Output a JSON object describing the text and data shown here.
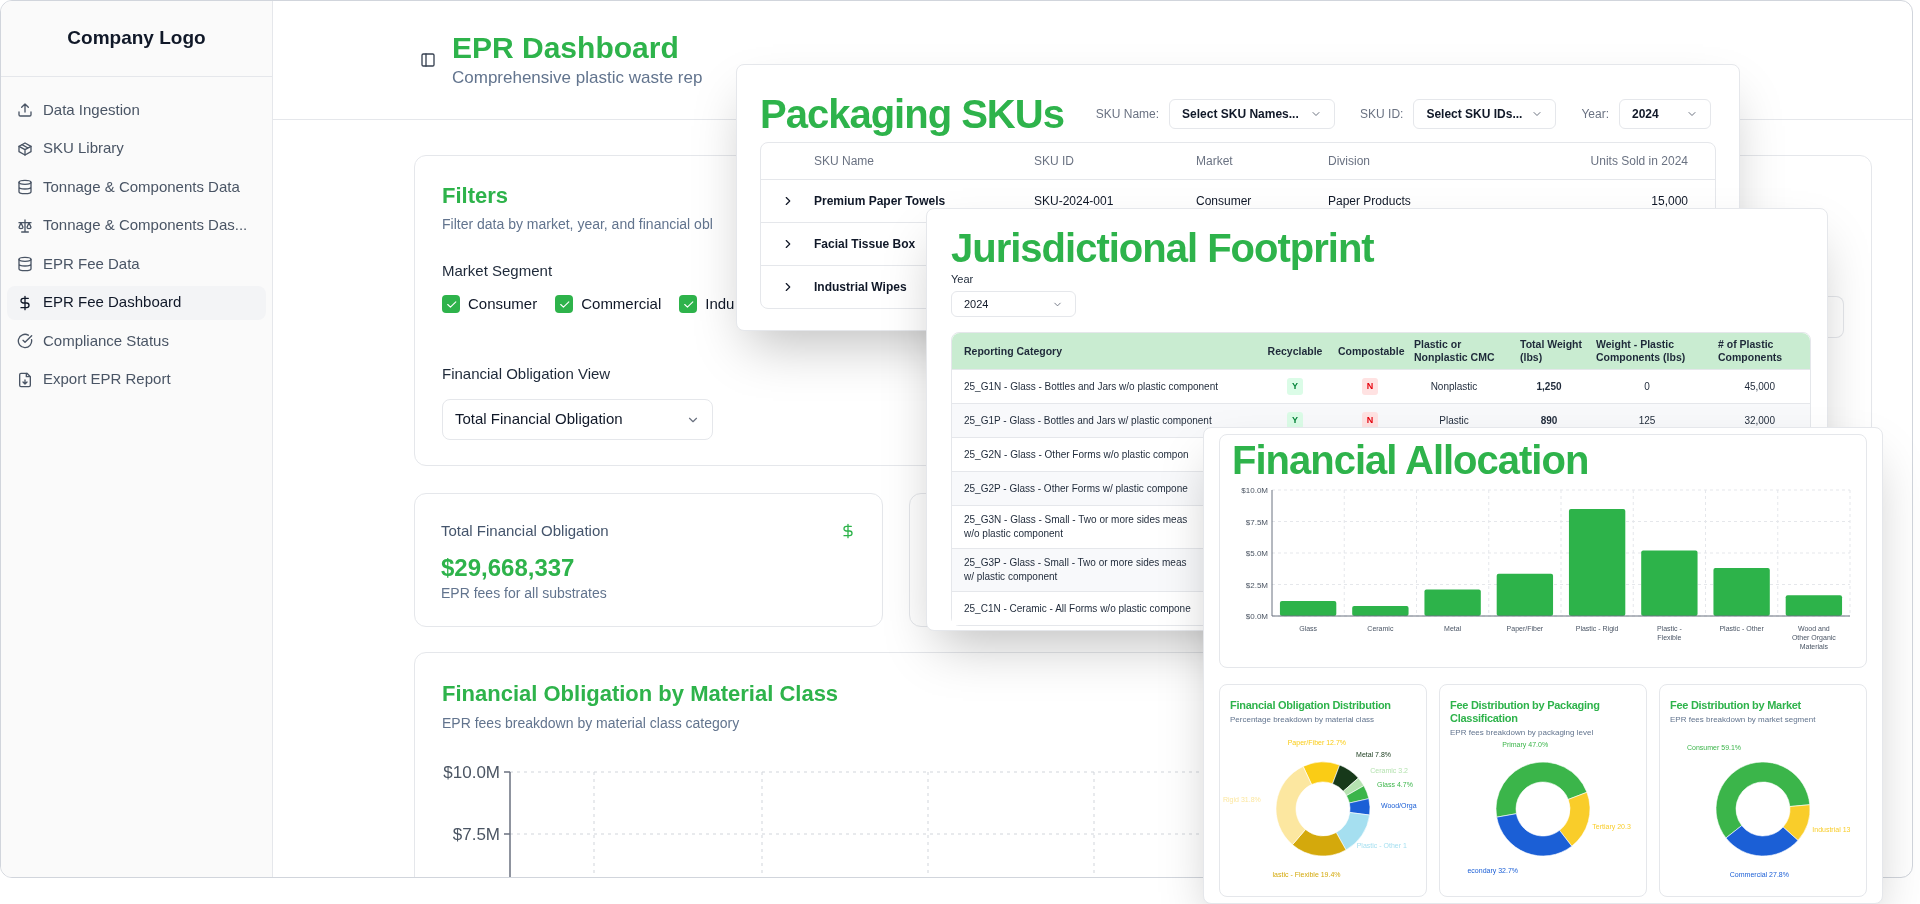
{
  "sidebar": {
    "logo": "Company Logo",
    "items": [
      {
        "label": "Data Ingestion",
        "selected": false
      },
      {
        "label": "SKU Library",
        "selected": false
      },
      {
        "label": "Tonnage & Components Data",
        "selected": false
      },
      {
        "label": "Tonnage & Components Das...",
        "selected": false
      },
      {
        "label": "EPR Fee Data",
        "selected": false
      },
      {
        "label": "EPR Fee Dashboard",
        "selected": true
      },
      {
        "label": "Compliance Status",
        "selected": false
      },
      {
        "label": "Export EPR Report",
        "selected": false
      }
    ]
  },
  "header": {
    "title": "EPR Dashboard",
    "subtitle": "Comprehensive plastic waste rep"
  },
  "filters": {
    "title": "Filters",
    "subtitle": "Filter data by market, year, and financial obl",
    "segment_label": "Market Segment",
    "segments": [
      {
        "label": "Consumer",
        "checked": true
      },
      {
        "label": "Commercial",
        "checked": true
      },
      {
        "label": "Indu",
        "checked": true
      }
    ],
    "view_label": "Financial Obligation View",
    "view_value": "Total Financial Obligation"
  },
  "total_card": {
    "title": "Total Financial Obligation",
    "value": "$29,668,337",
    "caption": "EPR fees for all substrates"
  },
  "material_chart": {
    "title": "Financial Obligation by Material Class",
    "subtitle": "EPR fees breakdown by material class category",
    "y_labels": [
      "$10.0M",
      "$7.5M"
    ]
  },
  "packaging": {
    "title": "Packaging SKUs",
    "filters": [
      {
        "label": "SKU Name:",
        "value": "Select SKU Names..."
      },
      {
        "label": "SKU ID:",
        "value": "Select SKU IDs..."
      },
      {
        "label": "Year:",
        "value": "2024"
      }
    ],
    "columns": [
      "SKU Name",
      "SKU ID",
      "Market",
      "Division",
      "Units Sold in 2024"
    ],
    "rows": [
      {
        "expanded": false,
        "cells": [
          "Premium Paper Towels",
          "SKU-2024-001",
          "Consumer",
          "Paper Products",
          "15,000"
        ]
      },
      {
        "expanded": false,
        "cells": [
          "Facial Tissue Box"
        ]
      },
      {
        "expanded": false,
        "cells": [
          "Industrial Wipes"
        ]
      }
    ]
  },
  "jurisdiction": {
    "title": "Jurisdictional Footprint",
    "year_label": "Year",
    "year_value": "2024",
    "columns": [
      "Reporting Category",
      "Recyclable",
      "Compostable",
      "Plastic or Nonplastic CMC",
      "Total Weight (lbs)",
      "Weight - Plastic Components (lbs)",
      "# of Plastic Components"
    ],
    "rows": [
      {
        "category": [
          "25_G1N - Glass - Bottles and Jars w/o plastic component"
        ],
        "recyclable": {
          "text": "Y",
          "positive": true
        },
        "compostable": {
          "text": "N",
          "positive": false
        },
        "material": "Nonplastic",
        "total_weight": "1,250",
        "plastic_weight": "0",
        "plastic_components": "45,000"
      },
      {
        "category": [
          "25_G1P - Glass - Bottles and Jars w/ plastic component"
        ],
        "recyclable": {
          "text": "Y",
          "positive": true
        },
        "compostable": {
          "text": "N",
          "positive": false
        },
        "material": "Plastic",
        "total_weight": "890",
        "plastic_weight": "125",
        "plastic_components": "32,000"
      },
      {
        "category": [
          "25_G2N - Glass - Other Forms w/o plastic compon"
        ]
      },
      {
        "category": [
          "25_G2P - Glass - Other Forms w/ plastic compone"
        ]
      },
      {
        "category": [
          "25_G3N - Glass - Small - Two or more sides meas",
          "w/o plastic component"
        ]
      },
      {
        "category": [
          "25_G3P - Glass - Small - Two or more sides meas",
          "w/ plastic component"
        ]
      },
      {
        "category": [
          "25_C1N - Ceramic - All Forms w/o plastic compone"
        ]
      }
    ]
  },
  "allocation": {
    "title": "Financial Allocation",
    "chart_data": {
      "type": "bar",
      "grid": true,
      "categories": [
        "Glass",
        "Ceramic",
        "Metal",
        "Paper/Fiber",
        "Plastic - Rigid",
        "Plastic - Flexible",
        "Plastic - Other",
        "Wood and Other Organic Materials"
      ],
      "values": [
        1.2,
        0.8,
        2.1,
        3.35,
        8.5,
        5.2,
        3.8,
        1.65
      ],
      "ylim": [
        0,
        10
      ],
      "yticks": [
        {
          "value": 0,
          "label": "$0.0M"
        },
        {
          "value": 2.5,
          "label": "$2.5M"
        },
        {
          "value": 5,
          "label": "$5.0M"
        },
        {
          "value": 7.5,
          "label": "$7.5M"
        },
        {
          "value": 10,
          "label": "$10.0M"
        }
      ]
    }
  },
  "donuts": [
    {
      "title": "Financial Obligation Distribution",
      "subtitle": "Percentage breakdown by material class",
      "chart_data": {
        "type": "donut",
        "categories": [
          "Paper/Fiber 12.7%",
          "Metal 7.8%",
          "Ceramic 3.2",
          "Glass 4.7%",
          "Wood/Orga",
          "Plastic - Other 1",
          "lastic - Flexible 19.4%",
          "Rigid 31.8%"
        ],
        "values": [
          12.7,
          7.8,
          3.2,
          4.7,
          5.6,
          14.8,
          19.4,
          31.8
        ],
        "colors": [
          "#facc15",
          "#17391a",
          "#b5e2b0",
          "#3bb54a",
          "#1b5fd6",
          "#a5dff0",
          "#d4a90c",
          "#fce7a0"
        ]
      }
    },
    {
      "title": "Fee Distribution by Packaging Classification",
      "subtitle": "EPR fees breakdown by packaging level",
      "chart_data": {
        "type": "donut",
        "categories": [
          "Primary 47.0%",
          "Tertiary 20.3",
          "econdary 32.7%"
        ],
        "values": [
          47.0,
          20.3,
          32.7
        ],
        "colors": [
          "#3bb54a",
          "#f9cd2a",
          "#1b5fd6"
        ]
      }
    },
    {
      "title": "Fee Distribution by Market",
      "subtitle": "EPR fees breakdown by market segment",
      "chart_data": {
        "type": "donut",
        "categories": [
          "Consumer 59.1%",
          "Industrial 13",
          "Commercial 27.8%"
        ],
        "values": [
          59.1,
          13.1,
          27.8
        ],
        "colors": [
          "#3bb54a",
          "#f9cd2a",
          "#1b5fd6"
        ]
      }
    }
  ]
}
